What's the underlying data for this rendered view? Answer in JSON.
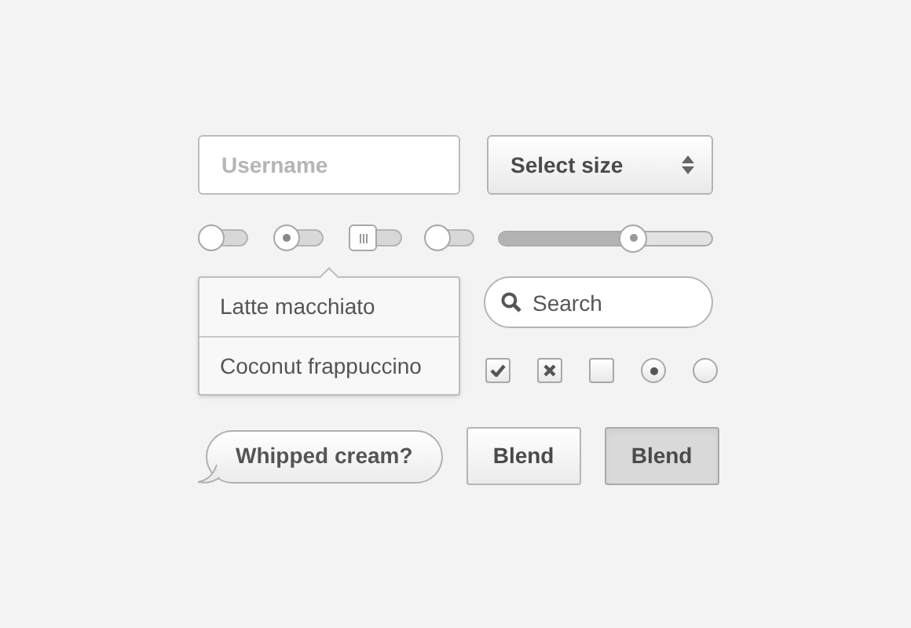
{
  "username": {
    "placeholder": "Username"
  },
  "select": {
    "value": "Select size"
  },
  "toggles": [
    {
      "kind": "round",
      "on": false
    },
    {
      "kind": "dot",
      "on": false
    },
    {
      "kind": "square",
      "on": false
    },
    {
      "kind": "round",
      "on": false
    }
  ],
  "slider": {
    "level": 0.63
  },
  "dropdown": {
    "items": [
      {
        "label": "Latte macchiato",
        "selected": false
      },
      {
        "label": "Coconut frappuccino",
        "selected": false
      }
    ]
  },
  "search": {
    "placeholder": "Search"
  },
  "choices": [
    {
      "kind": "tick",
      "checked": true
    },
    {
      "kind": "cross",
      "checked": true
    },
    {
      "kind": "tick",
      "checked": false
    },
    {
      "kind": "radio",
      "selected": true
    },
    {
      "kind": "radio",
      "selected": false
    }
  ],
  "bubble": {
    "text": "Whipped cream?"
  },
  "buttons": [
    {
      "label": "Blend",
      "pressed": false
    },
    {
      "label": "Blend",
      "pressed": true
    }
  ]
}
